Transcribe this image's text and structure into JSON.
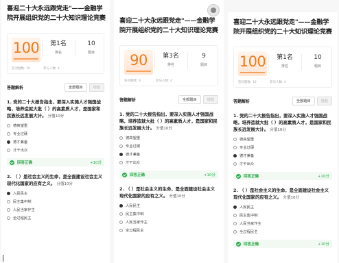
{
  "title": "喜迎二十大永远跟党走\"——金融学院开展组织党的二十大知识理论竞赛",
  "section_title": "答题解析",
  "buttons": {
    "all": "全部题目",
    "wrong": "错题"
  },
  "panels": [
    {
      "score": "100",
      "stats": [
        {
          "value": "第1名",
          "label": "排名"
        },
        {
          "value": "10",
          "label": "题目"
        }
      ],
      "foot": [
        "答对题数: 10",
        "参与人数: 4"
      ]
    },
    {
      "score": "90",
      "stats": [
        {
          "value": "第3名",
          "label": "排名"
        },
        {
          "value": "9",
          "label": "题目"
        }
      ],
      "foot": [
        "答对题数: 9",
        "参与人数: 4"
      ]
    },
    {
      "score": "100",
      "stats": [
        {
          "value": "第1名",
          "label": "排名"
        },
        {
          "value": "10",
          "label": "题目"
        }
      ],
      "foot": [
        "答对题数: 10",
        "参与人数: 4"
      ]
    }
  ],
  "q1": {
    "text": "1. 党的二十大报告指出，要深入实施人才强国战略，培养造就大批（ ）的高素质人才，是国家和民族长远发展大计。",
    "points": "分值10分",
    "options": [
      "德高望重",
      "专业过硬",
      "德才兼备",
      "才干出众"
    ],
    "selected": 2
  },
  "q2": {
    "text": "2. （ ）是社会主义的生命，是全面建设社会主义现代化国家的应有之义。",
    "points": "分值10分",
    "options": [
      "人民民主",
      "民主集中制",
      "人民当家作主",
      "全过程民主"
    ],
    "selected": 0
  },
  "answer": {
    "label": "回答正确",
    "points": "+10分"
  }
}
